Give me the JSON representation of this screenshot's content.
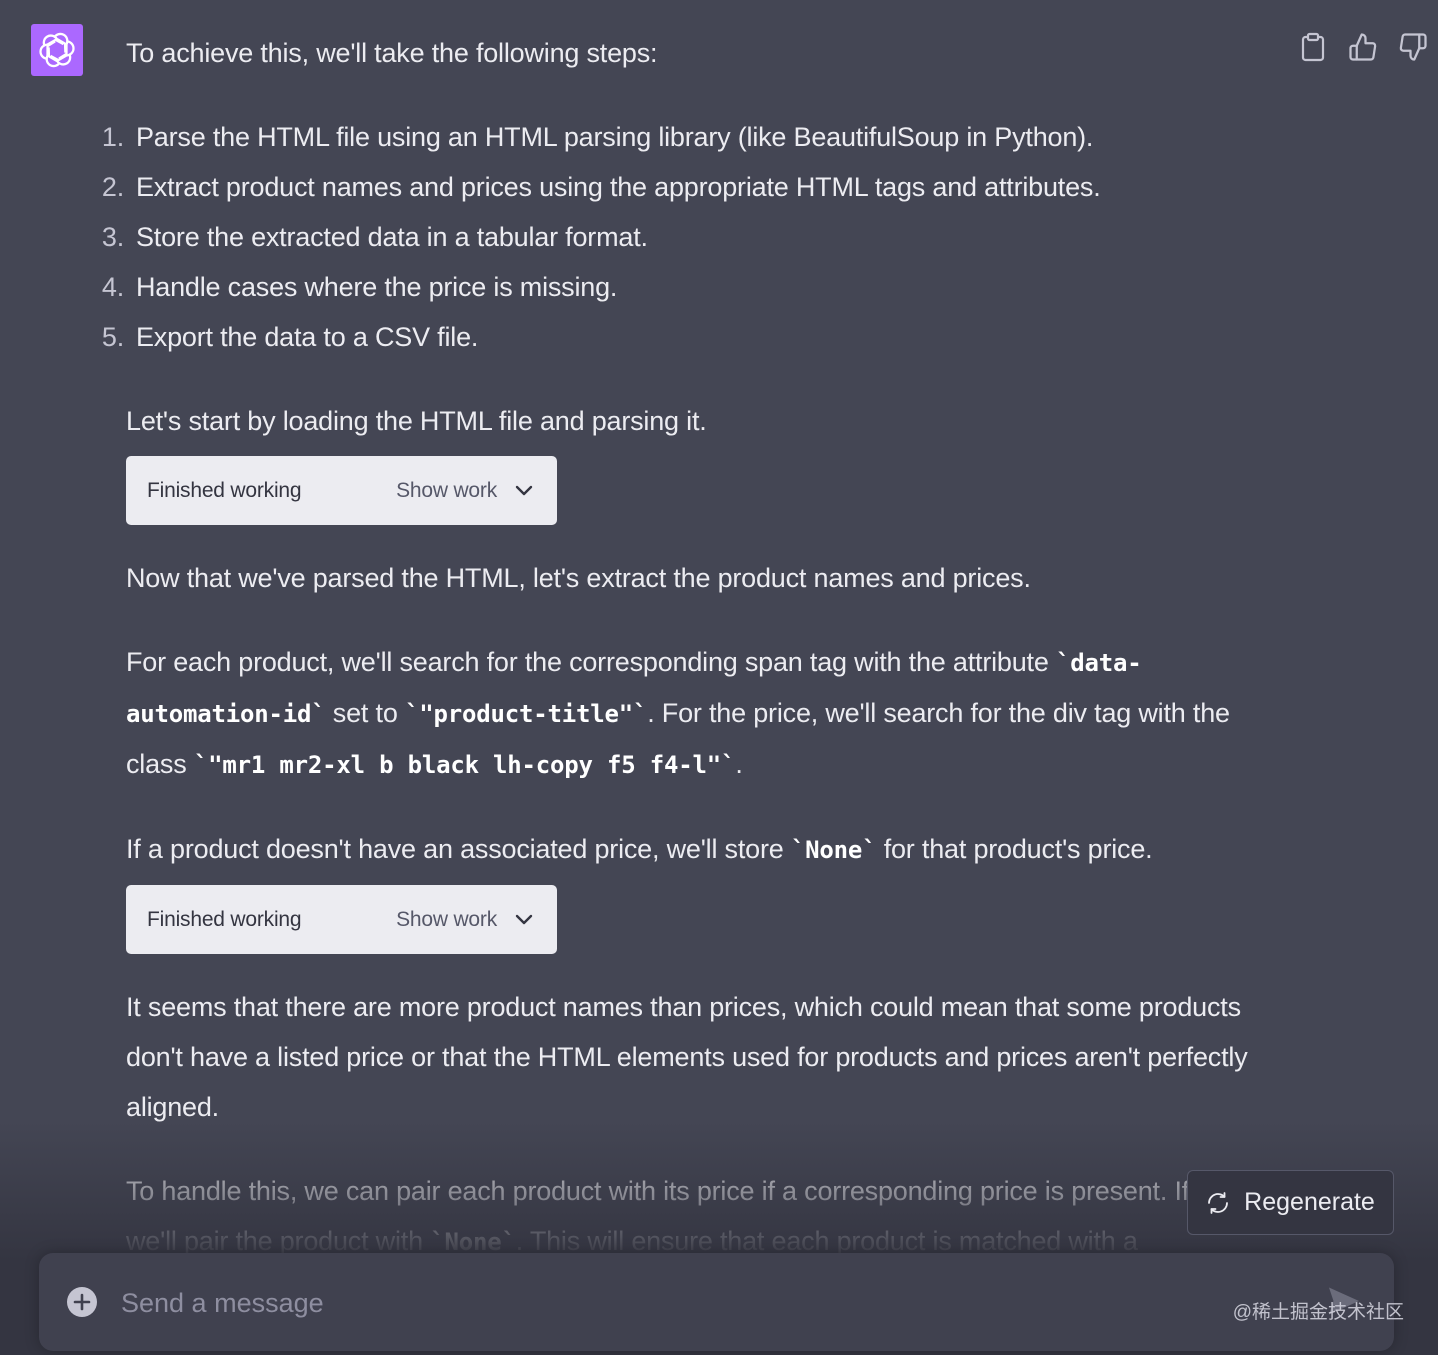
{
  "assistant": {
    "avatar_icon": "openai-logo-icon",
    "avatar_color": "#ab68ff"
  },
  "actions": [
    {
      "name": "copy-icon"
    },
    {
      "name": "thumbs-up-icon"
    },
    {
      "name": "thumbs-down-icon"
    }
  ],
  "message": {
    "intro": "To achieve this, we'll take the following steps:",
    "steps": [
      {
        "num": "1.",
        "text": "Parse the HTML file using an HTML parsing library (like BeautifulSoup in Python)."
      },
      {
        "num": "2.",
        "text": "Extract product names and prices using the appropriate HTML tags and attributes."
      },
      {
        "num": "3.",
        "text": "Store the extracted data in a tabular format."
      },
      {
        "num": "4.",
        "text": "Handle cases where the price is missing."
      },
      {
        "num": "5.",
        "text": "Export the data to a CSV file."
      }
    ],
    "p1": "Let's start by loading the HTML file and parsing it.",
    "work1": {
      "status": "Finished working",
      "toggle": "Show work"
    },
    "p2": "Now that we've parsed the HTML, let's extract the product names and prices.",
    "p3": {
      "t1": "For each product, we'll search for the corresponding span tag with the attribute ",
      "c1": "`data-automation-id`",
      "t2": " set to ",
      "c2": "`\"product-title\"`",
      "t3": ". For the price, we'll search for the div tag with the class ",
      "c3": "`\"mr1 mr2-xl b black lh-copy f5 f4-l\"`",
      "t4": "."
    },
    "p4": {
      "t1": "If a product doesn't have an associated price, we'll store ",
      "c1": "`None`",
      "t2": " for that product's price."
    },
    "work2": {
      "status": "Finished working",
      "toggle": "Show work"
    },
    "p5": "It seems that there are more product names than prices, which could mean that some products don't have a listed price or that the HTML elements used for products and prices aren't perfectly aligned.",
    "p6": {
      "t1": "To handle this, we can pair each product with its price if a corresponding price is present. If not, we'll pair the product with ",
      "c1": "`None`",
      "t2": ". This will ensure that each product is matched with a"
    }
  },
  "regenerate": {
    "label": "Regenerate",
    "icon": "refresh-icon"
  },
  "composer": {
    "placeholder": "Send a message",
    "plus_icon": "plus-circle-icon",
    "send_icon": "send-icon"
  },
  "watermark": "@稀土掘金技术社区"
}
